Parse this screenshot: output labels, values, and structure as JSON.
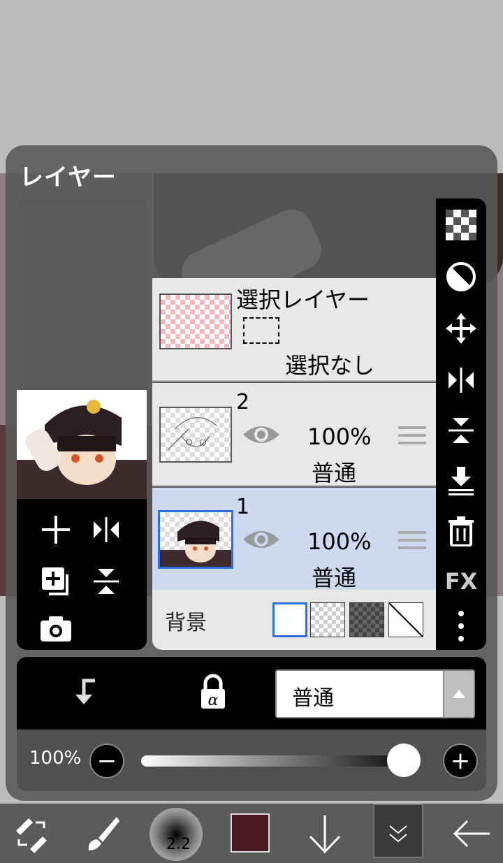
{
  "panel": {
    "title": "レイヤー"
  },
  "layers": {
    "selection_layer": {
      "title": "選択レイヤー",
      "status": "選択なし"
    },
    "items": [
      {
        "number": "2",
        "opacity": "100%",
        "blend": "普通",
        "visible": true
      },
      {
        "number": "1",
        "opacity": "100%",
        "blend": "普通",
        "visible": true,
        "selected": true
      }
    ],
    "background": {
      "label": "背景"
    }
  },
  "blend_bar": {
    "blend_mode": "普通"
  },
  "opacity_bar": {
    "label": "100%",
    "value": 100,
    "minus": "−",
    "plus": "+"
  },
  "side_toolbar": {
    "fx_label": "FX"
  },
  "bottom_toolbar": {
    "brush_size": "2.2",
    "color": "#4a1a22"
  },
  "colors": {
    "accent": "#2f6fe0",
    "selected_row": "#ccd9ee",
    "panel": "#585858"
  }
}
